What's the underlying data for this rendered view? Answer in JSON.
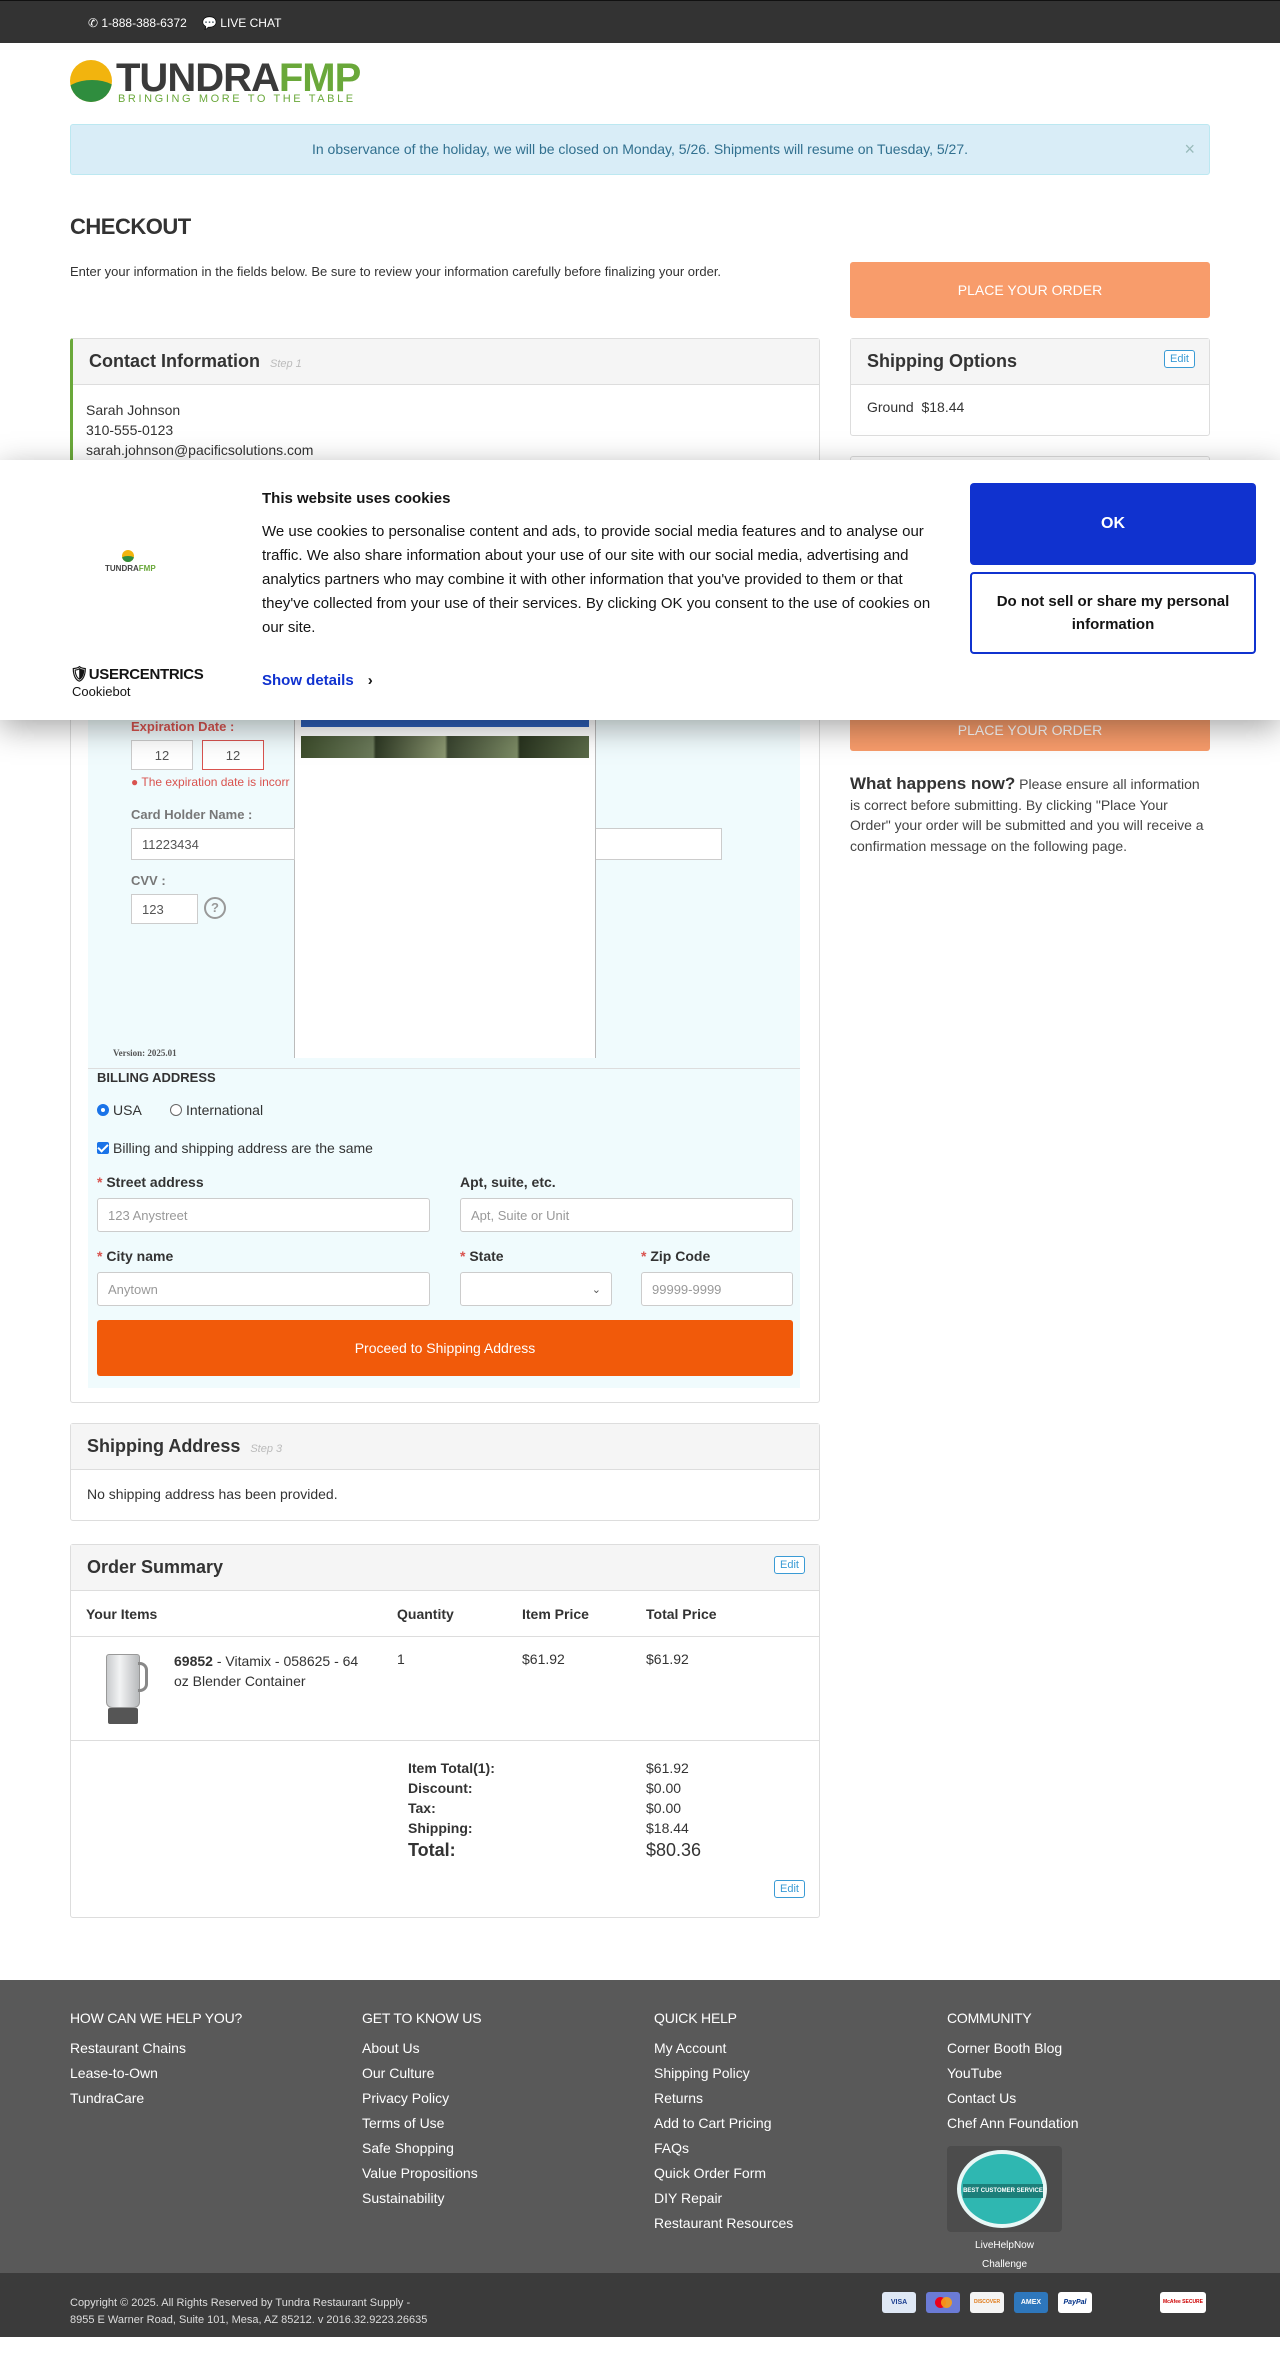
{
  "topbar": {
    "phone": "1-888-388-6372",
    "chat": "LIVE CHAT"
  },
  "brand": {
    "name_a": "TUNDRA",
    "name_b": "FMP",
    "tagline": "BRINGING MORE TO THE TABLE",
    "accent": "#6aa83a"
  },
  "alert": {
    "text": "In observance of the holiday, we will be closed on Monday, 5/26. Shipments will resume on Tuesday, 5/27.",
    "close": "×"
  },
  "page": {
    "title": "CHECKOUT",
    "intro": "Enter your information in the fields below. Be sure to review your information carefully before finalizing your order.",
    "place_order": "PLACE YOUR ORDER",
    "place_order_2": "PLACE YOUR ORDER"
  },
  "contact": {
    "title": "Contact Information",
    "step": "Step 1",
    "name": "Sarah Johnson",
    "phone": "310-555-0123",
    "email": "sarah.johnson@pacificsolutions.com"
  },
  "shipping_options": {
    "title": "Shipping Options",
    "edit": "Edit",
    "method": "Ground",
    "price": "$18.44"
  },
  "cookie": {
    "title": "This website uses cookies",
    "text": "We use cookies to personalise content and ads, to provide social media features and to analyse our traffic. We also share information about your use of our site with our social media, advertising and analytics partners who may combine it with other information that you've provided to them or that they've collected from your use of their services. By clicking OK you consent to the use of cookies on our site.",
    "logo_a": "TUNDRA",
    "logo_b": "FMP",
    "powered": "USERCENTRICS",
    "cookiebot": "Cookiebot",
    "show_details": "Show details",
    "ok": "OK",
    "do_not_sell": "Do not sell or share my personal information"
  },
  "payment": {
    "exp_label": "Expiration Date :",
    "exp_month": "12",
    "exp_year": "12",
    "exp_error": "The expiration date is incorr",
    "holder_label": "Card Holder Name :",
    "holder_value": "11223434",
    "cvv_label": "CVV :",
    "cvv_value": "123",
    "cvv_help": "?",
    "version": "Version: 2025.01"
  },
  "billing": {
    "title": "BILLING ADDRESS",
    "usa": "USA",
    "international": "International",
    "same": "Billing and shipping address are the same",
    "street_label": "Street address",
    "street_ph": "123 Anystreet",
    "apt_label": "Apt, suite, etc.",
    "apt_ph": "Apt, Suite or Unit",
    "city_label": "City name",
    "city_ph": "Anytown",
    "state_label": "State",
    "zip_label": "Zip Code",
    "zip_ph": "99999-9999",
    "proceed": "Proceed to Shipping Address"
  },
  "what_next": {
    "title": "What happens now?",
    "text": " Please ensure all information is correct before submitting. By clicking \"Place Your Order\" your order will be submitted and you will receive a confirmation message on the following page."
  },
  "shipping_address": {
    "title": "Shipping Address",
    "step": "Step 3",
    "empty": "No shipping address has been provided."
  },
  "summary": {
    "title": "Order Summary",
    "edit": "Edit",
    "edit2": "Edit",
    "headers": [
      "Your Items",
      "Quantity",
      "Item Price",
      "Total Price"
    ],
    "item": {
      "sku": "69852",
      "desc": " - Vitamix - 058625 - 64 oz Blender Container",
      "qty": "1",
      "price": "$61.92",
      "total": "$61.92"
    },
    "totals": {
      "item_total_l": "Item Total(1):",
      "item_total": "$61.92",
      "discount_l": "Discount:",
      "discount": "$0.00",
      "tax_l": "Tax:",
      "tax": "$0.00",
      "shipping_l": "Shipping:",
      "shipping": "$18.44",
      "total_l": "Total:",
      "total": "$80.36"
    }
  },
  "footer": {
    "cols": [
      {
        "title": "HOW CAN WE HELP YOU?",
        "links": [
          "Restaurant Chains",
          "Lease-to-Own",
          "TundraCare"
        ]
      },
      {
        "title": "GET TO KNOW US",
        "links": [
          "About Us",
          "Our Culture",
          "Privacy Policy",
          "Terms of Use",
          "Safe Shopping",
          "Value Propositions",
          "Sustainability"
        ]
      },
      {
        "title": "QUICK HELP",
        "links": [
          "My Account",
          "Shipping Policy",
          "Returns",
          "Add to Cart Pricing",
          "FAQs",
          "Quick Order Form",
          "DIY Repair",
          "Restaurant Resources"
        ]
      },
      {
        "title": "COMMUNITY",
        "links": [
          "Corner Booth Blog",
          "YouTube",
          "Contact Us",
          "Chef Ann Foundation"
        ]
      }
    ],
    "badge": "BEST CUSTOMER SERVICE",
    "badge_caption_1": "LiveHelpNow",
    "badge_caption_2": "Challenge",
    "copyright_1": "Copyright © 2025. All Rights Reserved by Tundra Restaurant Supply -",
    "copyright_2": "8955 E Warner Road, Suite 101, Mesa, AZ 85212. v 2016.32.9223.26635",
    "cards": [
      "VISA",
      "MC",
      "DISCOVER",
      "AMEX",
      "PayPal"
    ],
    "secure": "McAfee SECURE"
  }
}
